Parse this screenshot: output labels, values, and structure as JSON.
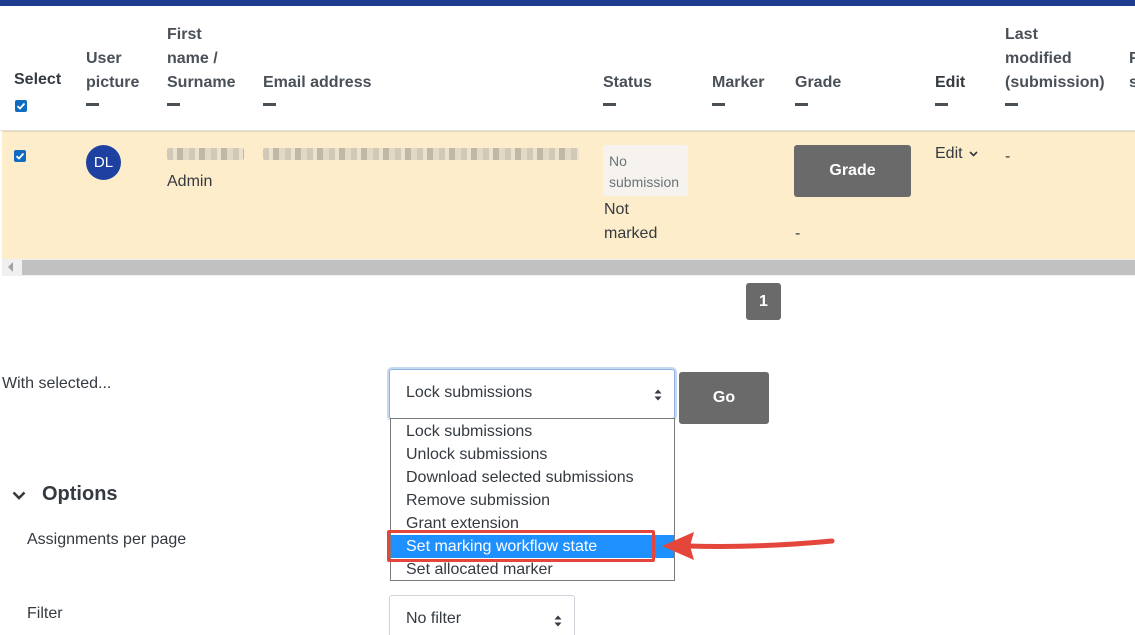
{
  "table": {
    "headers": {
      "select": "Select",
      "user_picture": [
        "User",
        "picture"
      ],
      "name": [
        "First",
        "name /",
        "Surname"
      ],
      "email": "Email address",
      "status": "Status",
      "marker": "Marker",
      "grade": "Grade",
      "edit": "Edit",
      "last_modified": [
        "Last",
        "modified",
        "(submission)"
      ],
      "next_col_partial": [
        "F",
        "s"
      ]
    },
    "row": {
      "avatar_initials": "DL",
      "surname": "Admin",
      "status_badge": [
        "No",
        "submission"
      ],
      "status_text": [
        "Not",
        "marked"
      ],
      "grade_button": "Grade",
      "grade_value": "-",
      "edit_label": "Edit",
      "last_modified": "-"
    }
  },
  "pagination": {
    "current": "1"
  },
  "bulk": {
    "label": "With selected...",
    "selected": "Lock submissions",
    "go": "Go",
    "options": [
      "Lock submissions",
      "Unlock submissions",
      "Download selected submissions",
      "Remove submission",
      "Grant extension",
      "Set marking workflow state",
      "Set allocated marker"
    ],
    "highlighted_index": 5
  },
  "options_section": {
    "title": "Options",
    "assignments_per_page": "Assignments per page",
    "filter_label": "Filter",
    "filter_value": "No filter"
  },
  "colors": {
    "brand_bar": "#1d3c8f",
    "row_highlight": "#fdedca",
    "button": "#6a6a6a",
    "annotation": "#e4463b",
    "selection": "#1e90ff"
  }
}
